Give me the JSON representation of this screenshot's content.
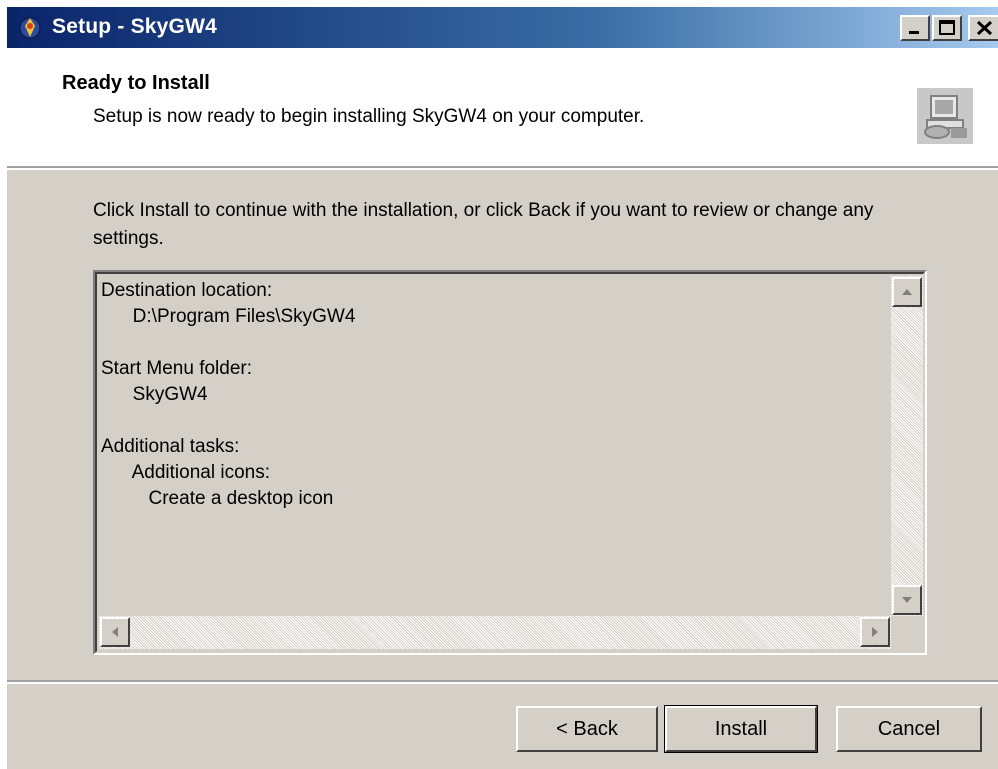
{
  "window": {
    "title": "Setup - SkyGW4",
    "icon": "setup-app-icon",
    "caption_buttons": [
      "minimize-icon",
      "maximize-icon",
      "close-icon"
    ]
  },
  "header": {
    "title": "Ready to Install",
    "subtitle": "Setup is now ready to begin installing SkyGW4 on your computer.",
    "image": "installer-computer-icon"
  },
  "instructions": "Click Install to continue with the installation, or click Back if you want to review or change any settings.",
  "memo": {
    "lines": [
      "Destination location:",
      "      D:\\Program Files\\SkyGW4",
      "",
      "Start Menu folder:",
      "      SkyGW4",
      "",
      "Additional tasks:",
      "      Additional icons:",
      "         Create a desktop icon"
    ]
  },
  "buttons": {
    "back": "< Back",
    "install": "Install",
    "cancel": "Cancel"
  }
}
